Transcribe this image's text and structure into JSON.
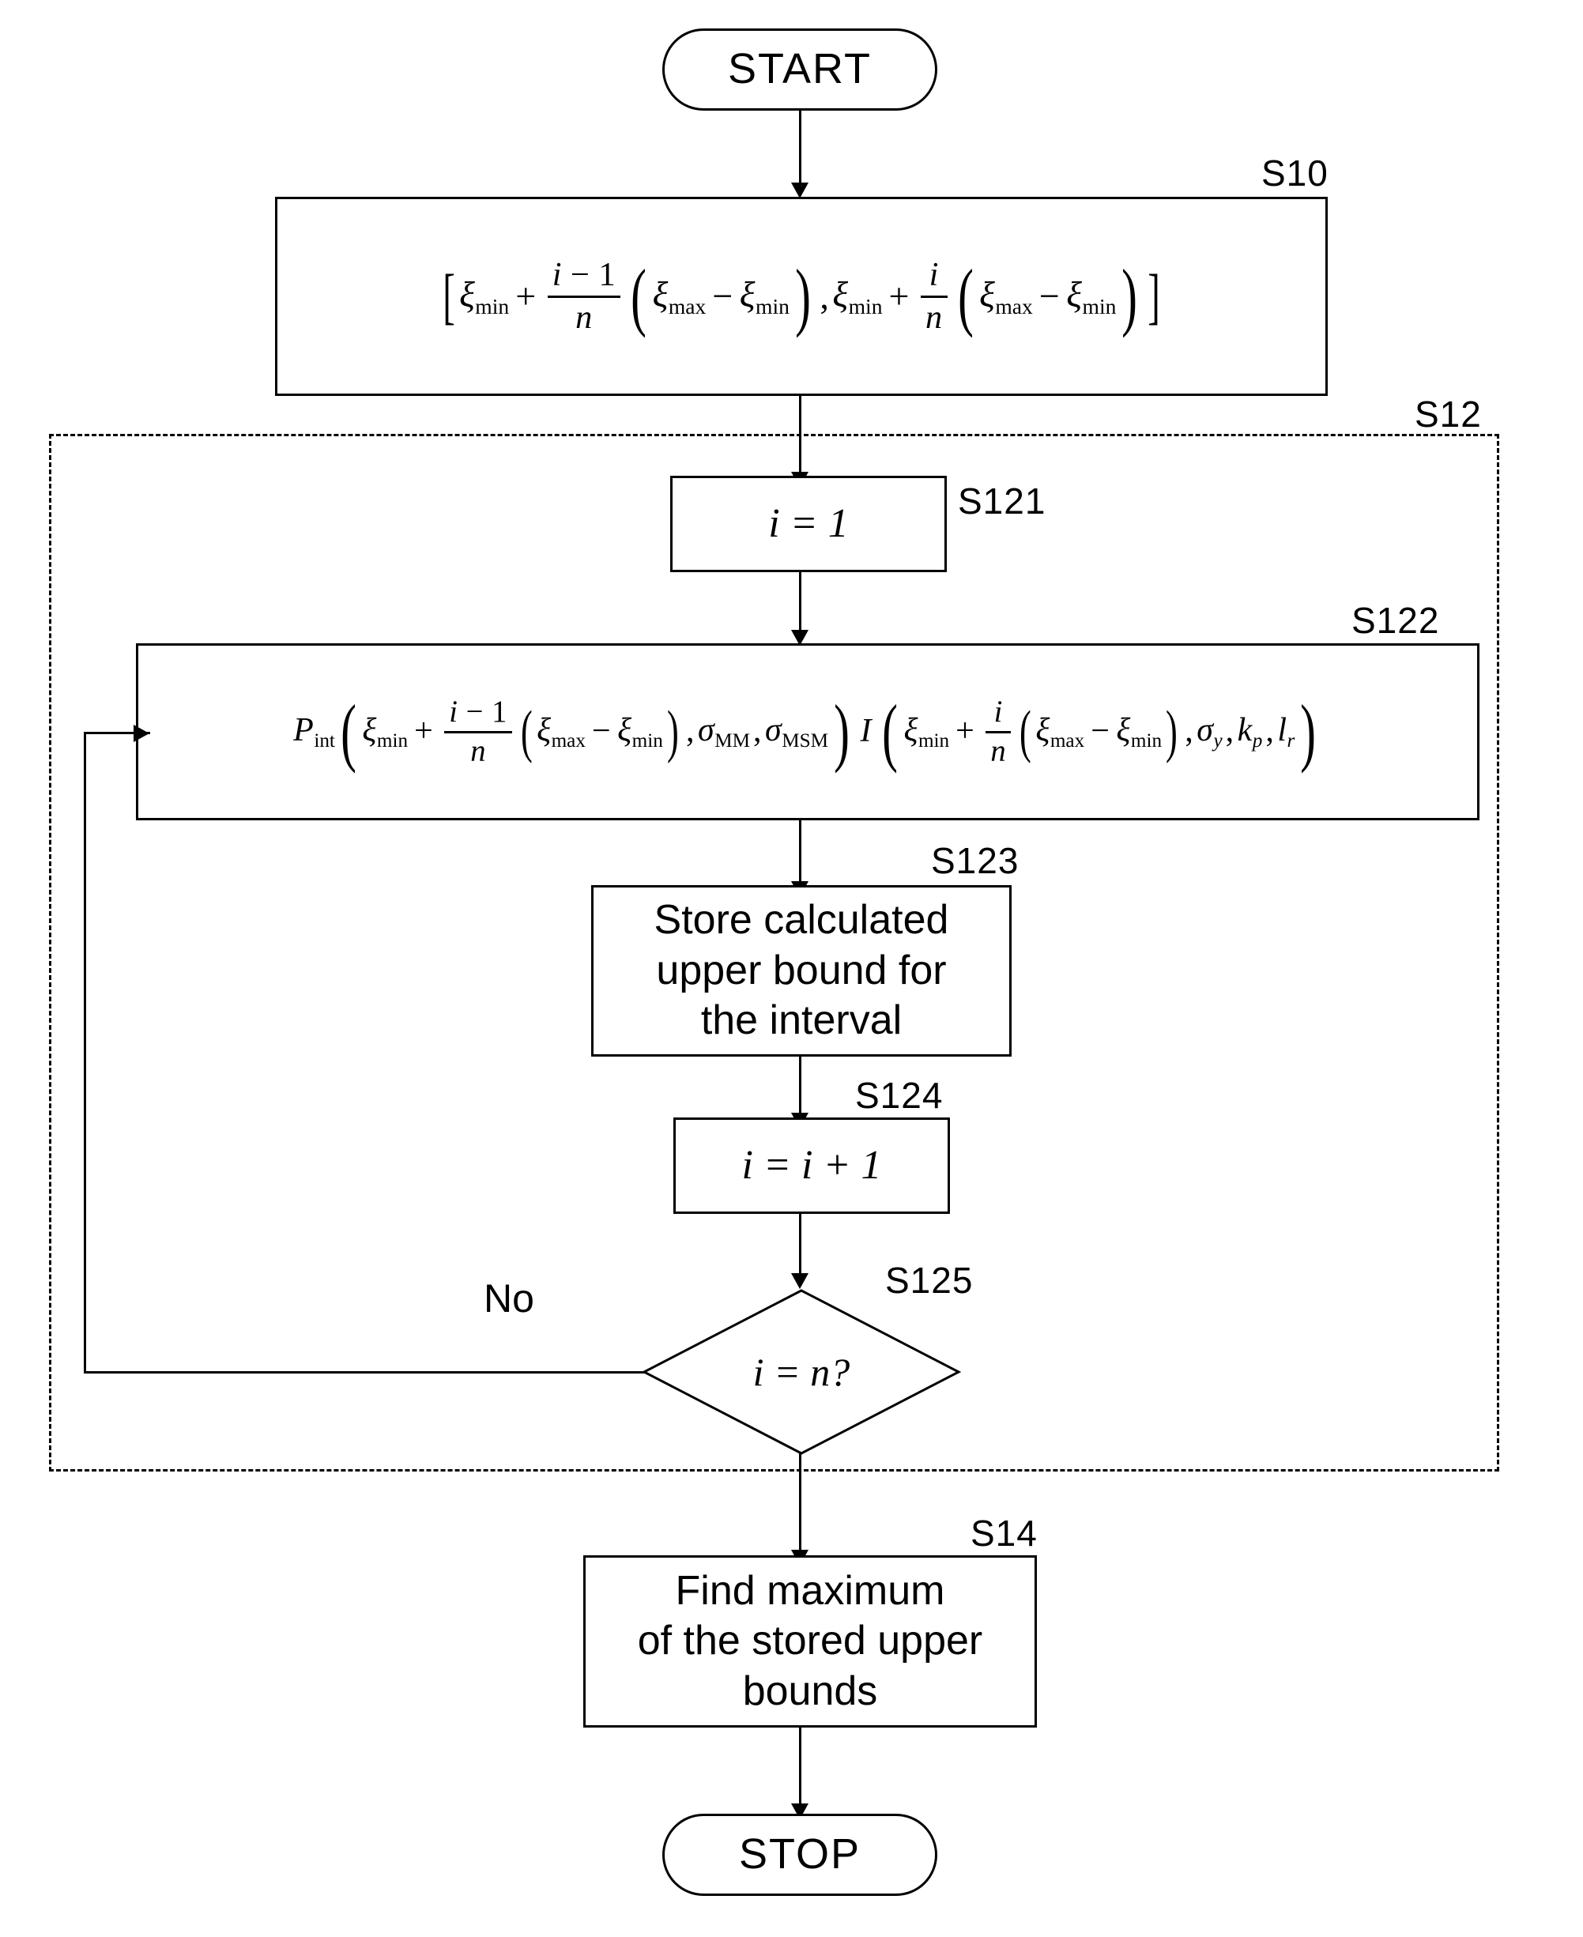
{
  "diagram": {
    "type": "flowchart",
    "title": "Flowchart for computing upper bounds over intervals"
  },
  "nodes": {
    "start": {
      "label": "START",
      "shape": "terminal"
    },
    "stop": {
      "label": "STOP",
      "shape": "terminal"
    },
    "s10": {
      "step": "S10",
      "shape": "formula-box",
      "formula_text": "[ ξ_min + ((i−1)/n)(ξ_max − ξ_min), ξ_min + (i/n)(ξ_max − ξ_min) ]",
      "parts": {
        "open_bracket": "[",
        "xi": "ξ",
        "sub_min": "min",
        "sub_max": "max",
        "plus": "+",
        "minus": "−",
        "comma": ",",
        "num1": "i − 1",
        "den1": "n",
        "num2": "i",
        "den2": "n",
        "close_bracket": "]"
      }
    },
    "s12": {
      "step": "S12",
      "shape": "dashed-group"
    },
    "s121": {
      "step": "S121",
      "shape": "process",
      "label": "i = 1"
    },
    "s122": {
      "step": "S122",
      "shape": "formula-box",
      "formula_text": "P_int( ξ_min + ((i−1)/n)(ξ_max − ξ_min), σ_MM, σ_MSM ) I( ξ_min + (i/n)(ξ_max − ξ_min), σ_y, k_p, l_r )",
      "parts": {
        "P": "P",
        "P_sub": "int",
        "I": "I",
        "sigma": "σ",
        "sigma1_sub": "MM",
        "sigma2_sub": "MSM",
        "sigma3_sub": "y",
        "k": "k",
        "k_sub": "p",
        "l": "l",
        "l_sub": "r"
      }
    },
    "s123": {
      "step": "S123",
      "shape": "process",
      "lines": [
        "Store calculated",
        "upper bound for",
        "the interval"
      ]
    },
    "s124": {
      "step": "S124",
      "shape": "process",
      "label": "i = i + 1"
    },
    "s125": {
      "step": "S125",
      "shape": "decision",
      "label": "i = n?"
    },
    "s14": {
      "step": "S14",
      "shape": "process",
      "lines": [
        "Find maximum",
        "of the stored upper",
        "bounds"
      ]
    }
  },
  "edges": {
    "no_label": "No"
  },
  "colors": {
    "stroke": "#000000",
    "background": "#ffffff"
  }
}
